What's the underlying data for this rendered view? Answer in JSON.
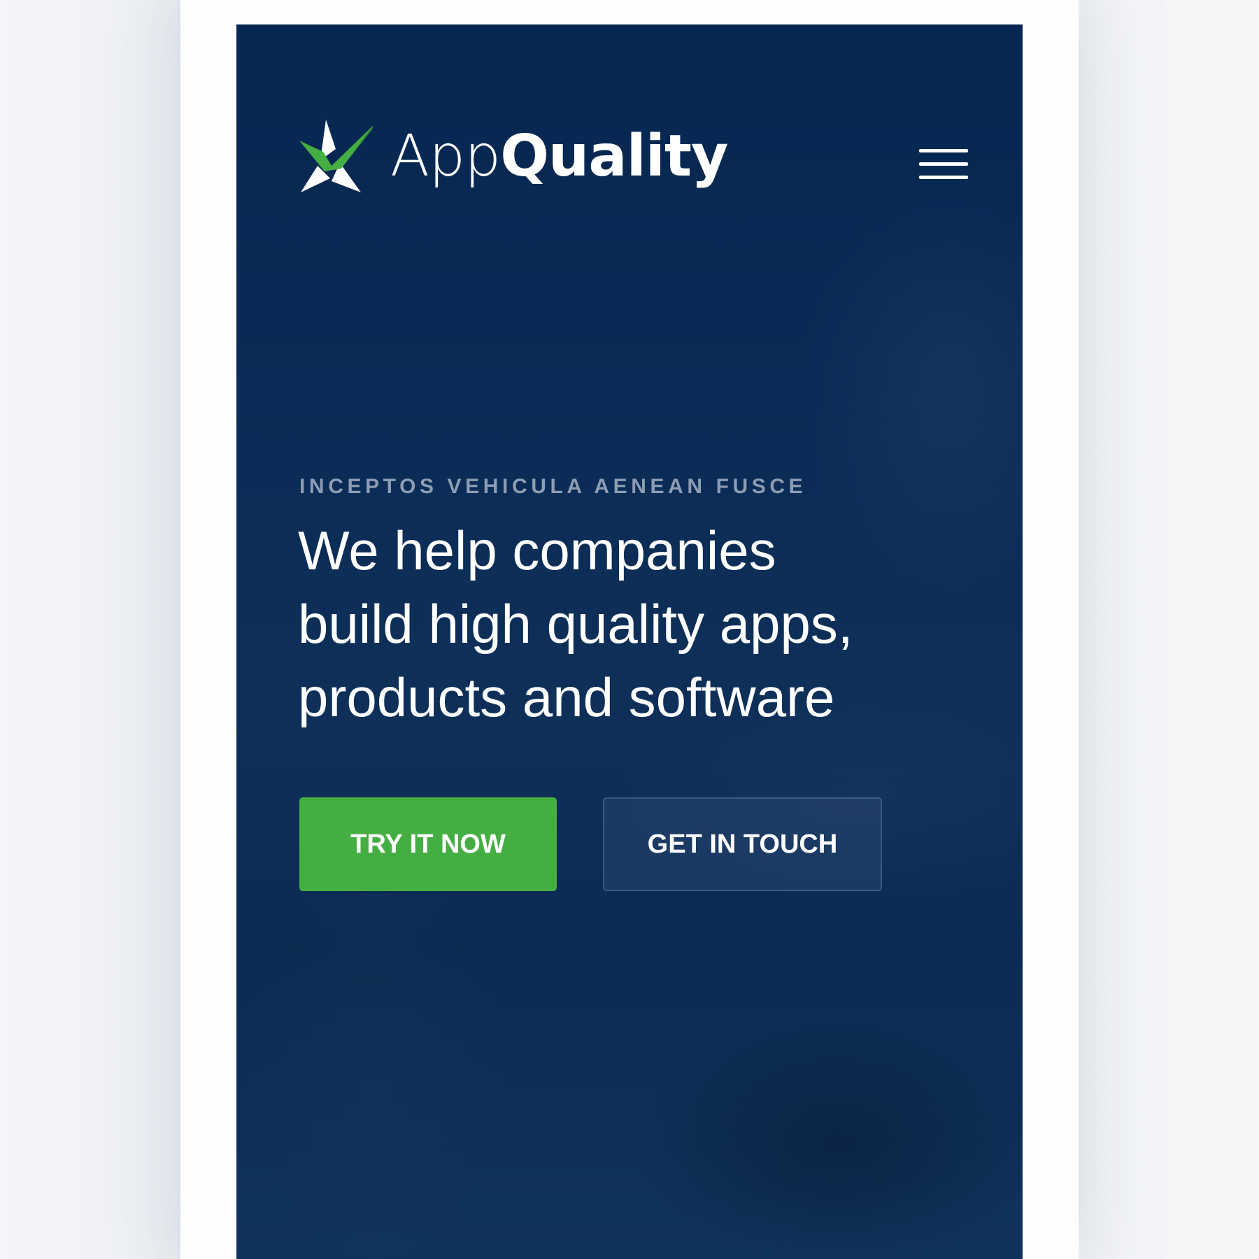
{
  "brand": {
    "name_light": "App",
    "name_bold": "Quality",
    "accent_color": "#45ae43",
    "background_color": "#062750"
  },
  "header": {
    "menu_icon": "hamburger-menu-icon"
  },
  "hero": {
    "eyebrow": "INCEPTOS VEHICULA AENEAN FUSCE",
    "headline_line1": "We help companies",
    "headline_line2": "build high quality apps,",
    "headline_line3": "products and software"
  },
  "actions": {
    "primary_label": "TRY IT NOW",
    "secondary_label": "GET IN TOUCH"
  }
}
